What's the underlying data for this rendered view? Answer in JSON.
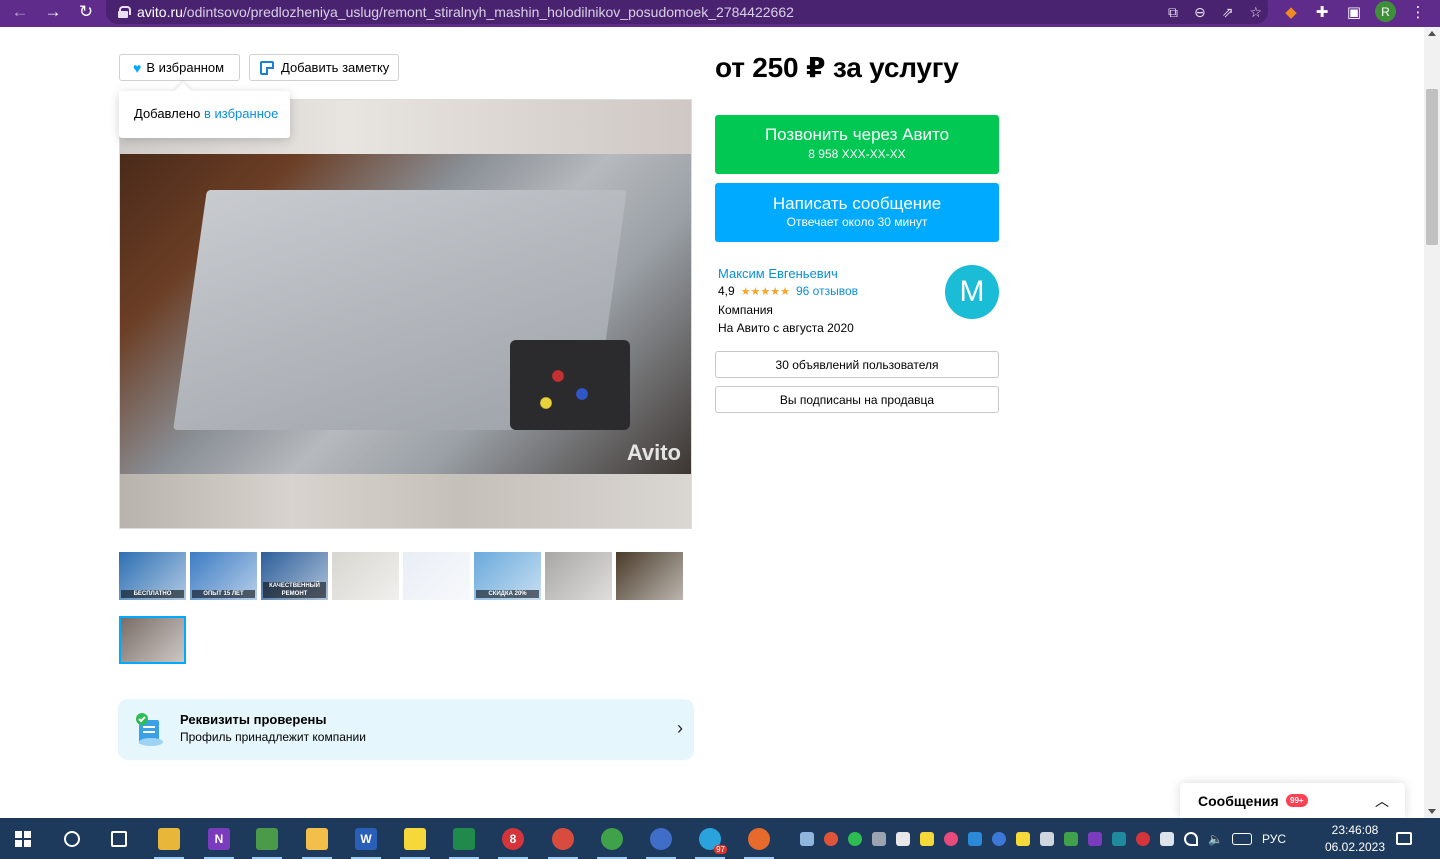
{
  "browser": {
    "url_host": "avito.ru",
    "url_path": "/odintsovo/predlozheniya_uslug/remont_stiralnyh_mashin_holodilnikov_posudomoek_2784422662",
    "profile_initial": "R"
  },
  "listing": {
    "favorite_label": "В избранном",
    "add_note_label": "Добавить заметку",
    "tooltip_prefix": "Добавлено",
    "tooltip_link": "в избранное",
    "price": "от 250 ₽ за услугу",
    "photo_watermark": "Avito",
    "thumbnails": [
      {
        "caption": "БЕСПЛАТНО",
        "color": "#2d6fb3"
      },
      {
        "caption": "ОПЫТ 15 ЛЕТ",
        "color": "#3d7cc4"
      },
      {
        "caption": "КАЧЕСТВЕННЫЙ РЕМОНТ",
        "color": "#2c5e9a"
      },
      {
        "caption": "",
        "color": "#d8d6d0"
      },
      {
        "caption": "",
        "color": "#e9eef5"
      },
      {
        "caption": "СКИДКА 20%",
        "color": "#6aa9dc"
      },
      {
        "caption": "",
        "color": "#a9a7a4"
      },
      {
        "caption": "",
        "color": "#4a3b2a"
      },
      {
        "caption": "",
        "color": "#7a6d66"
      }
    ],
    "requisites_title": "Реквизиты проверены",
    "requisites_subtitle": "Профиль принадлежит компании"
  },
  "contact": {
    "call_label": "Позвонить через Авито",
    "call_phone": "8 958 XXX-XX-XX",
    "message_label": "Написать сообщение",
    "message_sub": "Отвечает около 30 минут"
  },
  "seller": {
    "name": "Максим Евгеньевич",
    "rating": "4,9",
    "stars": "★★★★★",
    "reviews": "96 отзывов",
    "type": "Компания",
    "since": "На Авито с августа 2020",
    "avatar_letter": "M",
    "listings_button": "30 объявлений пользователя",
    "subscribed_button": "Вы подписаны на продавца"
  },
  "messages_widget": {
    "title": "Сообщения",
    "badge": "99+"
  },
  "taskbar": {
    "items": [
      {
        "icon": "search-icon",
        "color": "",
        "label": ""
      },
      {
        "icon": "task-view-icon",
        "color": "",
        "label": ""
      },
      {
        "icon": "file-explorer-icon",
        "color": "#e8b73a",
        "label": ""
      },
      {
        "icon": "onenote-icon",
        "color": "#7b3bbd",
        "label": "N"
      },
      {
        "icon": "notepad-icon",
        "color": "#4a9a4a",
        "label": ""
      },
      {
        "icon": "folder-icon",
        "color": "#f2c04a",
        "label": ""
      },
      {
        "icon": "word-icon",
        "color": "#2a5fb8",
        "label": "W"
      },
      {
        "icon": "sticky-notes-icon",
        "color": "#f5d93a",
        "label": ""
      },
      {
        "icon": "excel-icon",
        "color": "#1f8a4c",
        "label": ""
      },
      {
        "icon": "yandex-icon",
        "color": "#d4343a",
        "label": "8"
      },
      {
        "icon": "chrome-icon",
        "color": "#d94c3d",
        "label": ""
      },
      {
        "icon": "chrome-profile-icon",
        "color": "#3fa14a",
        "label": ""
      },
      {
        "icon": "chrome-alt-icon",
        "color": "#3f6dc8",
        "label": ""
      },
      {
        "icon": "telegram-icon",
        "color": "#2aa3dd",
        "label": ""
      },
      {
        "icon": "firefox-icon",
        "color": "#e66a2c",
        "label": ""
      }
    ],
    "telegram_badge": "97",
    "language": "РУС",
    "time": "23:46:08",
    "date": "06.02.2023"
  }
}
